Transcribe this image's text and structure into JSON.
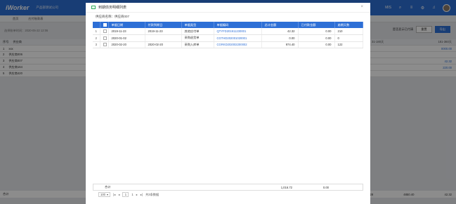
{
  "app": {
    "logo": "iWorker",
    "company": "产品部测试公司",
    "user_initials": "MIS"
  },
  "background": {
    "tabs": [
      "首页",
      "应付账款表"
    ],
    "filter_text": "选择账单时间：2020-05-22 12:06",
    "table_header": [
      "序号",
      "供应商"
    ],
    "rows": [
      {
        "idx": "1",
        "name": "xxx",
        "v1": "",
        "v2": "0000.00"
      },
      {
        "idx": "2",
        "name": "供应商006",
        "v1": "",
        "v2": ""
      },
      {
        "idx": "3",
        "name": "供应商007",
        "v1": "",
        "v2": "42.32"
      },
      {
        "idx": "4",
        "name": "供应商164",
        "v1": "",
        "v2": "220.00"
      },
      {
        "idx": "5",
        "name": "供应商420",
        "v1": "",
        "v2": ""
      }
    ],
    "right_headers": [
      "31-180天",
      "181-360天"
    ],
    "buttons": {
      "reset": "重置",
      "export": "导出"
    },
    "checkbox_label": "是否显示已付清",
    "footer_label": "合计",
    "footer_values": [
      "8.28",
      "4850.40",
      "42.32"
    ]
  },
  "modal": {
    "title": "到期债务明细列表",
    "supplier_label": "供应商名称：供应商007",
    "columns": [
      "",
      "",
      "单据日期",
      "付款到期日",
      "单据类型",
      "单据编码",
      "总计金额",
      "已付款金额",
      "逾期天数"
    ],
    "rows": [
      {
        "idx": "1",
        "date": "2019-11-23",
        "due": "2019-11-23",
        "type": "其他应付单",
        "code": "QTYFD201911230001",
        "total": "42.32",
        "paid": "0.00",
        "overdue": "210"
      },
      {
        "idx": "2",
        "date": "2020-01-02",
        "due": "",
        "type": "采购退货单",
        "code": "CGTHD202001020001",
        "total": "0.00",
        "paid": "0.00",
        "overdue": "0"
      },
      {
        "idx": "3",
        "date": "2020-02-20",
        "due": "2020-02-20",
        "type": "采购入库单",
        "code": "CGRKD202002200002",
        "total": "974.40",
        "paid": "0.00",
        "overdue": "122"
      }
    ],
    "summary": {
      "label": "合计",
      "total": "1,016.72",
      "paid": "0.00"
    },
    "pager": {
      "page_size": "100",
      "page": "1",
      "total_pages": "1",
      "total_text": "共3条数据"
    }
  }
}
